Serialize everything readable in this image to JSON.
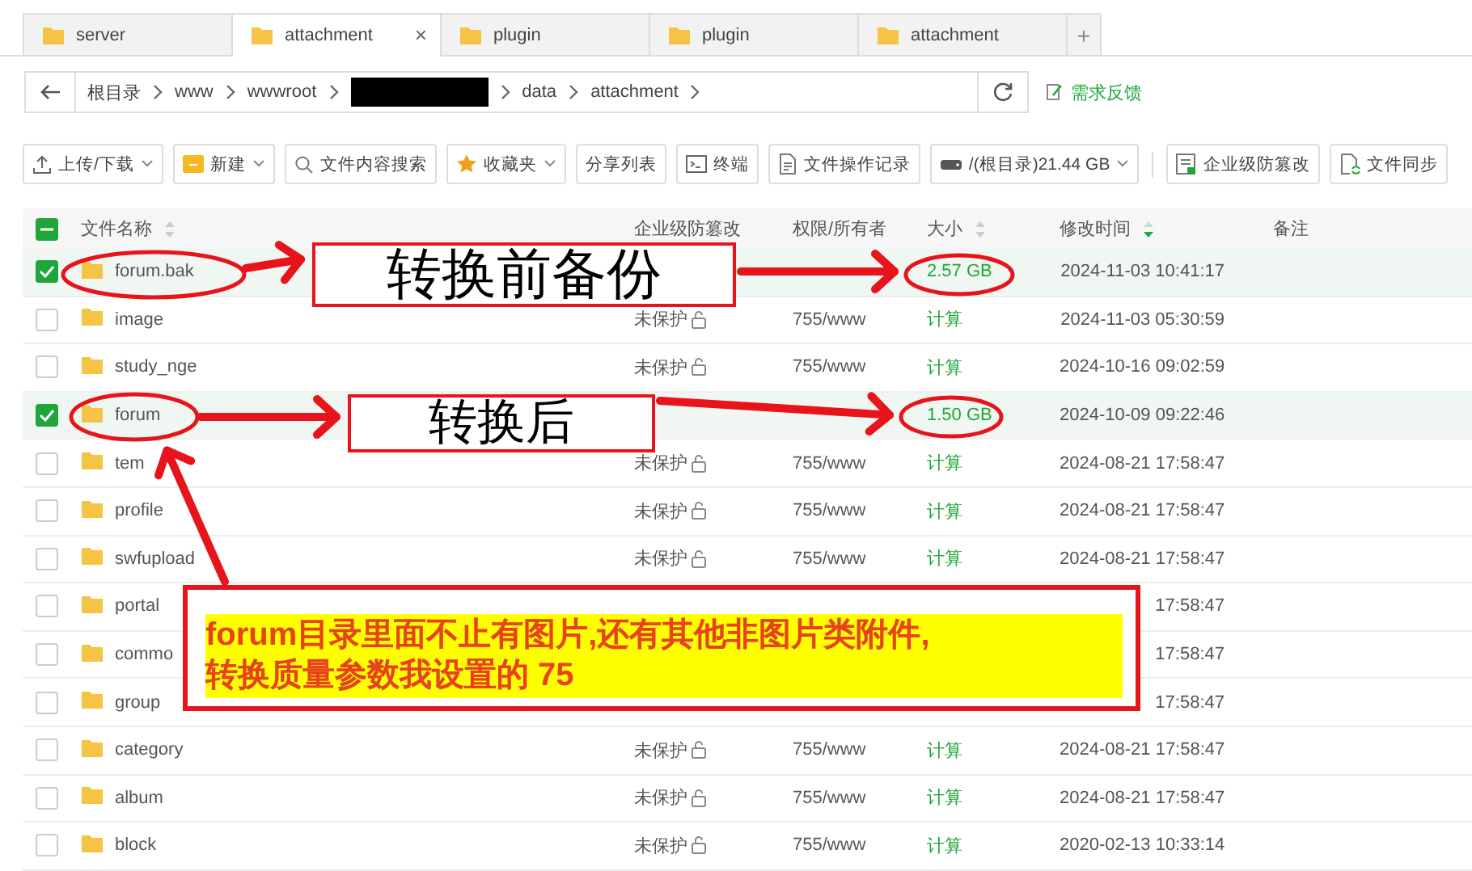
{
  "tabs": [
    {
      "label": "server",
      "selected": false
    },
    {
      "label": "attachment",
      "selected": true,
      "close": "×"
    },
    {
      "label": "plugin",
      "selected": false
    },
    {
      "label": "plugin",
      "selected": false
    },
    {
      "label": "attachment",
      "selected": false
    }
  ],
  "new_tab": "+",
  "path": {
    "segments": [
      {
        "kind": "text",
        "label": "根目录"
      },
      {
        "kind": "text",
        "label": "www"
      },
      {
        "kind": "text",
        "label": "wwwroot"
      },
      {
        "kind": "redacted"
      },
      {
        "kind": "text",
        "label": "data"
      },
      {
        "kind": "text",
        "label": "attachment"
      }
    ],
    "feedback": "需求反馈"
  },
  "toolbar": {
    "main": [
      {
        "label": "上传/下载",
        "dropdown": true
      },
      {
        "label": "新建",
        "dropdown": true
      },
      {
        "label": "文件内容搜索",
        "dropdown": false
      },
      {
        "label": "收藏夹",
        "dropdown": true
      },
      {
        "label": "分享列表",
        "dropdown": false
      },
      {
        "label": "终端",
        "dropdown": false
      },
      {
        "label": "文件操作记录",
        "dropdown": false
      },
      {
        "label": "/(根目录)21.44 GB",
        "dropdown": true
      }
    ],
    "end": [
      {
        "label": "企业级防篡改",
        "dropdown": false
      },
      {
        "label": "文件同步",
        "dropdown": false
      }
    ]
  },
  "table": {
    "select_all": {
      "indeterminate": true
    },
    "columns": [
      {
        "label": "文件名称",
        "sortable": true,
        "sorted": false
      },
      {
        "label": "企业级防篡改"
      },
      {
        "label": "权限/所有者"
      },
      {
        "label": "大小",
        "sortable": true,
        "sorted": false
      },
      {
        "label": "修改时间",
        "sortable": true,
        "sorted": true
      },
      {
        "label": "备注"
      }
    ],
    "rows": [
      {
        "checked": true,
        "name": "forum.bak",
        "size": "2.57 GB",
        "modified": "2024-11-03 10:41:17"
      },
      {
        "checked": false,
        "name": "image",
        "protection": "未保护",
        "permissions": "755/www",
        "size": "计算",
        "modified": "2024-11-03 05:30:59"
      },
      {
        "checked": false,
        "name": "study_nge",
        "protection": "未保护",
        "permissions": "755/www",
        "size": "计算",
        "modified": "2024-10-16 09:02:59"
      },
      {
        "checked": true,
        "name": "forum",
        "size": "1.50 GB",
        "modified": "2024-10-09 09:22:46"
      },
      {
        "checked": false,
        "name": "tem",
        "protection": "未保护",
        "permissions": "755/www",
        "size": "计算",
        "modified": "2024-08-21 17:58:47"
      },
      {
        "checked": false,
        "name": "profile",
        "protection": "未保护",
        "permissions": "755/www",
        "size": "计算",
        "modified": "2024-08-21 17:58:47"
      },
      {
        "checked": false,
        "name": "swfupload",
        "protection": "未保护",
        "permissions": "755/www",
        "size": "计算",
        "modified": "2024-08-21 17:58:47"
      },
      {
        "checked": false,
        "name": "portal",
        "modified": "17:58:47"
      },
      {
        "checked": false,
        "name": "commo",
        "modified": "17:58:47"
      },
      {
        "checked": false,
        "name": "group",
        "modified": "17:58:47"
      },
      {
        "checked": false,
        "name": "category",
        "protection": "未保护",
        "permissions": "755/www",
        "size": "计算",
        "modified": "2024-08-21 17:58:47"
      },
      {
        "checked": false,
        "name": "album",
        "protection": "未保护",
        "permissions": "755/www",
        "size": "计算",
        "modified": "2024-08-21 17:58:47"
      },
      {
        "checked": false,
        "name": "block",
        "protection": "未保护",
        "permissions": "755/www",
        "size": "计算",
        "modified": "2020-02-13 10:33:14"
      }
    ]
  },
  "annotations": [
    {
      "kind": "label",
      "text": "转换前备份"
    },
    {
      "kind": "label",
      "text": "转换后"
    },
    {
      "kind": "note",
      "lines": [
        "forum目录里面不止有图片,还有其他非图片类附件,",
        "转换质量参数我设置的 75"
      ]
    }
  ]
}
